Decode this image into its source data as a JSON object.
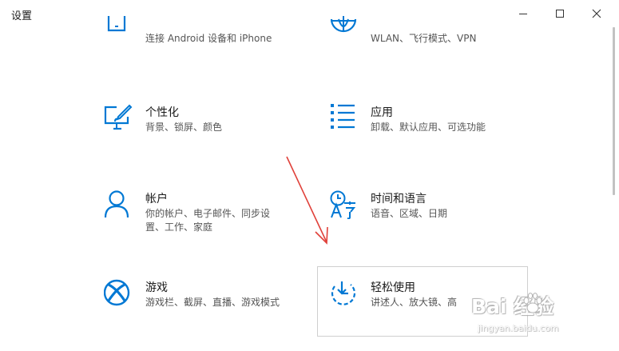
{
  "window": {
    "title": "设置",
    "controls": [
      "minimize-icon",
      "maximize-icon",
      "close-icon"
    ]
  },
  "accent": "#0078d4",
  "tiles": [
    {
      "id": "phone",
      "icon": "phone-icon",
      "title": "",
      "desc": "连接 Android 设备和 iPhone"
    },
    {
      "id": "network",
      "icon": "globe-icon",
      "title": "",
      "desc": "WLAN、飞行模式、VPN"
    },
    {
      "id": "personalization",
      "icon": "paint-monitor-icon",
      "title": "个性化",
      "desc": "背景、锁屏、颜色"
    },
    {
      "id": "apps",
      "icon": "apps-list-icon",
      "title": "应用",
      "desc": "卸载、默认应用、可选功能"
    },
    {
      "id": "accounts",
      "icon": "person-icon",
      "title": "帐户",
      "desc_lines": [
        "你的帐户、电子邮件、同步设",
        "置、工作、家庭"
      ]
    },
    {
      "id": "time-language",
      "icon": "clock-language-icon",
      "title": "时间和语言",
      "desc": "语音、区域、日期"
    },
    {
      "id": "gaming",
      "icon": "xbox-icon",
      "title": "游戏",
      "desc": "游戏栏、截屏、直播、游戏模式"
    },
    {
      "id": "ease-of-access",
      "icon": "ease-of-access-icon",
      "title": "轻松使用",
      "desc": "讲述人、放大镜、高"
    }
  ],
  "watermark": {
    "logo": "Bai  经验",
    "url": "jingyan.baidu.com"
  }
}
